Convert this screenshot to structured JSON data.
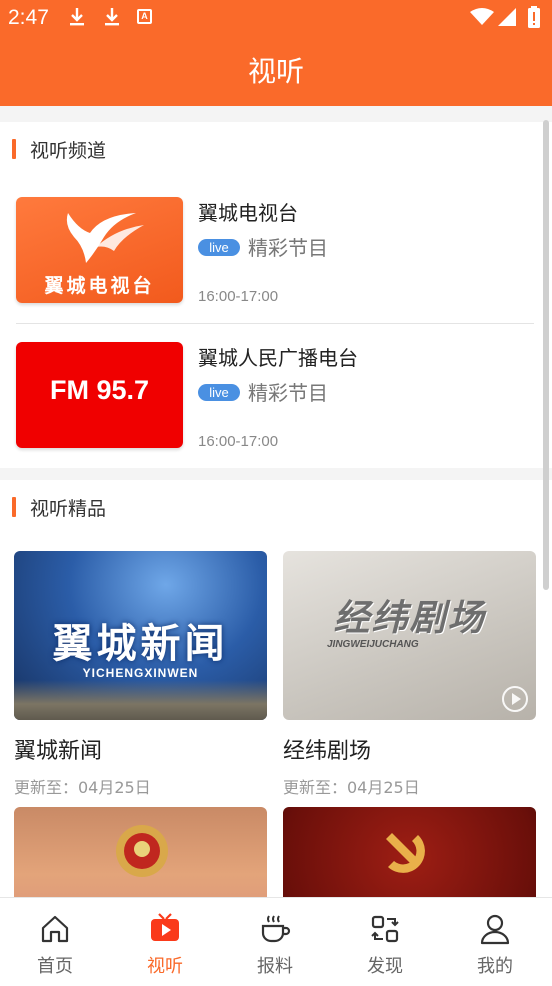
{
  "status_bar": {
    "time": "2:47",
    "notification_icons": [
      "download-icon",
      "download-icon",
      "a-icon"
    ]
  },
  "header": {
    "title": "视听"
  },
  "channels_section": {
    "title": "视听频道",
    "items": [
      {
        "name": "翼城电视台",
        "logo_text": "翼城电视台",
        "badge": "live",
        "description": "精彩节目",
        "time": "16:00-17:00"
      },
      {
        "name": "翼城人民广播电台",
        "logo_text": "FM 95.7",
        "badge": "live",
        "description": "精彩节目",
        "time": "16:00-17:00"
      }
    ]
  },
  "programs_section": {
    "title": "视听精品",
    "items": [
      {
        "title": "翼城新闻",
        "updated": "更新至：04月25日",
        "image_title": "翼城新闻",
        "image_subtitle": "YICHENGXINWEN"
      },
      {
        "title": "经纬剧场",
        "updated": "更新至：04月25日",
        "image_title": "经纬剧场",
        "image_subtitle": "JINGWEIJUCHANG"
      },
      {
        "title": "",
        "updated": ""
      },
      {
        "title": "",
        "updated": ""
      }
    ]
  },
  "tab_bar": {
    "items": [
      {
        "label": "首页",
        "icon": "home-icon"
      },
      {
        "label": "视听",
        "icon": "tv-icon",
        "active": true
      },
      {
        "label": "报料",
        "icon": "coffee-cup-icon"
      },
      {
        "label": "发现",
        "icon": "discover-icon"
      },
      {
        "label": "我的",
        "icon": "user-icon"
      }
    ]
  },
  "colors": {
    "accent": "#fa6a2a",
    "live_badge": "#4a90e2",
    "fm_logo": "#f00000"
  }
}
